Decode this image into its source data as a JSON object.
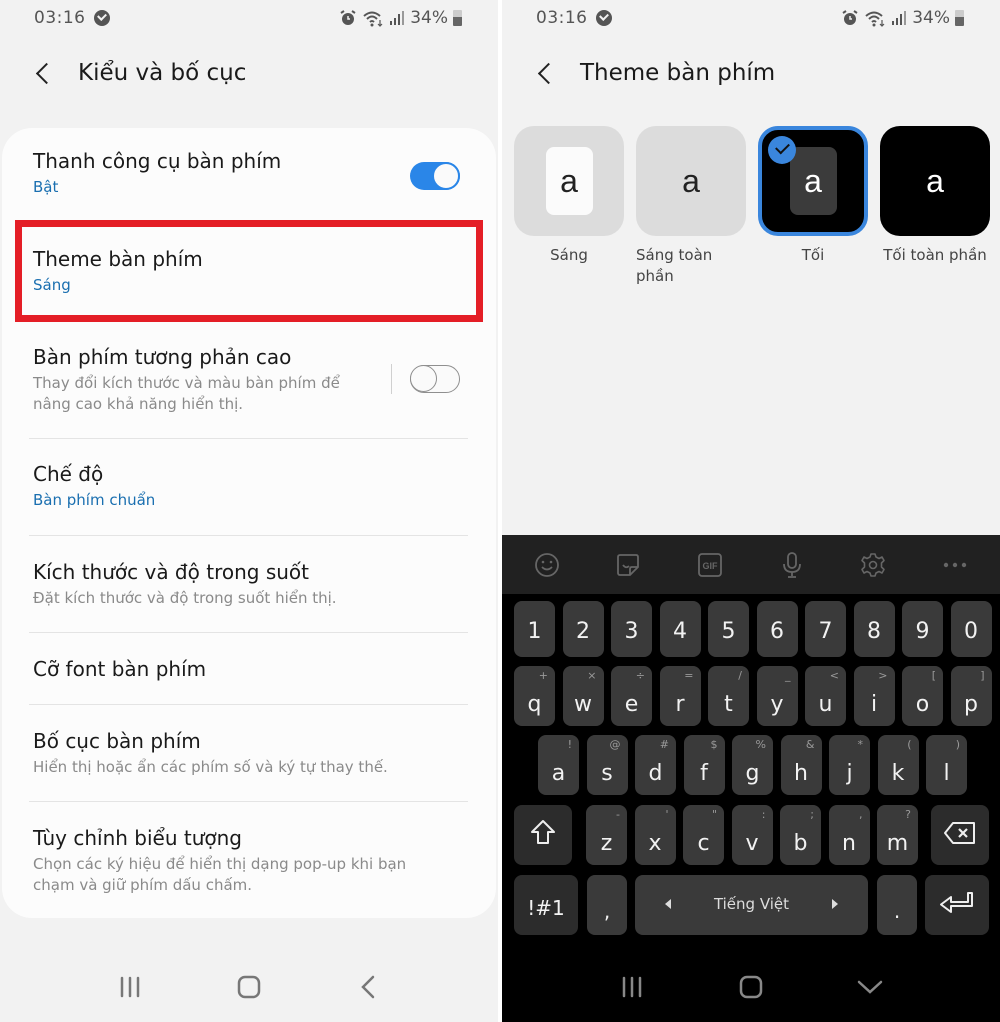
{
  "status_bar": {
    "time": "03:16",
    "battery": "34%"
  },
  "left_screen": {
    "title": "Kiểu và bố cục",
    "items": [
      {
        "title": "Thanh công cụ bàn phím",
        "subtitle": "Bật",
        "toggle": "on"
      },
      {
        "title": "Theme bàn phím",
        "subtitle": "Sáng",
        "highlighted": true
      },
      {
        "title": "Bàn phím tương phản cao",
        "subtitle": "Thay đổi kích thước và màu bàn phím để nâng cao khả năng hiển thị.",
        "toggle": "off"
      },
      {
        "title": "Chế độ",
        "subtitle": "Bàn phím chuẩn"
      },
      {
        "title": "Kích thước và độ trong suốt",
        "subtitle": "Đặt kích thước và độ trong suốt hiển thị."
      },
      {
        "title": "Cỡ font bàn phím"
      },
      {
        "title": "Bố cục bàn phím",
        "subtitle": "Hiển thị hoặc ẩn các phím số và ký tự thay thế."
      },
      {
        "title": "Tùy chỉnh biểu tượng",
        "subtitle": "Chọn các ký hiệu để hiển thị dạng pop-up khi bạn chạm và giữ phím dấu chấm."
      }
    ]
  },
  "right_screen": {
    "title": "Theme bàn phím",
    "themes": [
      {
        "label": "Sáng",
        "glyph": "a",
        "selected": false
      },
      {
        "label": "Sáng toàn phần",
        "glyph": "a",
        "selected": false
      },
      {
        "label": "Tối",
        "glyph": "a",
        "selected": true
      },
      {
        "label": "Tối toàn phần",
        "glyph": "a",
        "selected": false
      }
    ],
    "keyboard": {
      "toolbar": [
        "emoji-icon",
        "sticker-icon",
        "gif-icon",
        "microphone-icon",
        "settings-icon",
        "more-icon"
      ],
      "gif_label": "GIF",
      "row_numbers": [
        "1",
        "2",
        "3",
        "4",
        "5",
        "6",
        "7",
        "8",
        "9",
        "0"
      ],
      "row1": [
        {
          "k": "q",
          "h": "+"
        },
        {
          "k": "w",
          "h": "×"
        },
        {
          "k": "e",
          "h": "÷"
        },
        {
          "k": "r",
          "h": "="
        },
        {
          "k": "t",
          "h": "/"
        },
        {
          "k": "y",
          "h": "_"
        },
        {
          "k": "u",
          "h": "<"
        },
        {
          "k": "i",
          "h": ">"
        },
        {
          "k": "o",
          "h": "["
        },
        {
          "k": "p",
          "h": "]"
        }
      ],
      "row2": [
        {
          "k": "a",
          "h": "!"
        },
        {
          "k": "s",
          "h": "@"
        },
        {
          "k": "d",
          "h": "#"
        },
        {
          "k": "f",
          "h": "$"
        },
        {
          "k": "g",
          "h": "%"
        },
        {
          "k": "h",
          "h": "&"
        },
        {
          "k": "j",
          "h": "*"
        },
        {
          "k": "k",
          "h": "("
        },
        {
          "k": "l",
          "h": ")"
        }
      ],
      "row3": [
        {
          "k": "z",
          "h": "-"
        },
        {
          "k": "x",
          "h": "'"
        },
        {
          "k": "c",
          "h": "\""
        },
        {
          "k": "v",
          "h": ":"
        },
        {
          "k": "b",
          "h": ";"
        },
        {
          "k": "n",
          "h": ","
        },
        {
          "k": "m",
          "h": "?"
        }
      ],
      "symbols_label": "!#1",
      "comma_label": ",",
      "space_label": "Tiếng Việt",
      "period_label": "."
    }
  }
}
